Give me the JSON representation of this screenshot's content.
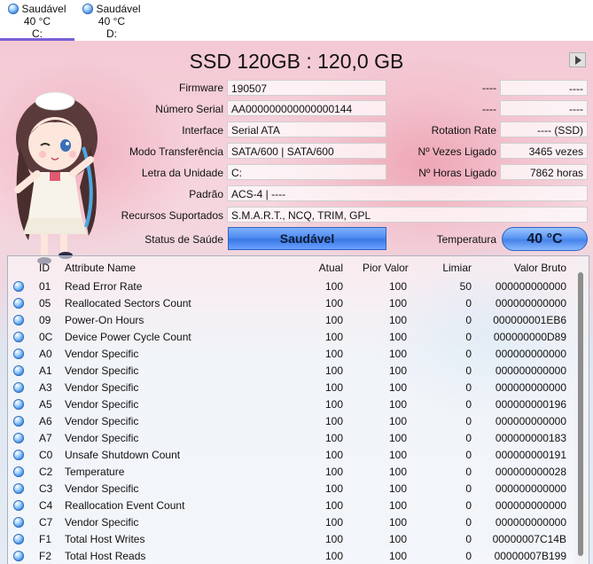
{
  "disks": [
    {
      "status": "Saudável",
      "temp": "40 °C",
      "letter": "C:"
    },
    {
      "status": "Saudável",
      "temp": "40 °C",
      "letter": "D:"
    }
  ],
  "title": "SSD 120GB : 120,0 GB",
  "info": {
    "firmware_label": "Firmware",
    "firmware": "190507",
    "serial_label": "Número Serial",
    "serial": "AA000000000000000144",
    "interface_label": "Interface",
    "interface": "Serial ATA",
    "transfer_label": "Modo Transferência",
    "transfer": "SATA/600 | SATA/600",
    "letter_label": "Letra da Unidade",
    "letter": "C:",
    "standard_label": "Padrão",
    "standard": "ACS-4 | ----",
    "features_label": "Recursos Suportados",
    "features": "S.M.A.R.T., NCQ, TRIM, GPL",
    "health_label": "Status de Saúde",
    "health": "Saudável",
    "temp_label": "Temperatura",
    "temp": "40 °C"
  },
  "right_info": {
    "r1_label": "----",
    "r1": "----",
    "r2_label": "----",
    "r2": "----",
    "rotation_label": "Rotation Rate",
    "rotation": "---- (SSD)",
    "power_count_label": "Nº Vezes Ligado",
    "power_count": "3465 vezes",
    "power_hours_label": "Nº Horas Ligado",
    "power_hours": "7862 horas"
  },
  "table": {
    "headers": {
      "id": "ID",
      "name": "Attribute Name",
      "current": "Atual",
      "worst": "Pior Valor",
      "threshold": "Limiar",
      "raw": "Valor Bruto"
    },
    "rows": [
      {
        "id": "01",
        "name": "Read Error Rate",
        "current": "100",
        "worst": "100",
        "threshold": "50",
        "raw": "000000000000"
      },
      {
        "id": "05",
        "name": "Reallocated Sectors Count",
        "current": "100",
        "worst": "100",
        "threshold": "0",
        "raw": "000000000000"
      },
      {
        "id": "09",
        "name": "Power-On Hours",
        "current": "100",
        "worst": "100",
        "threshold": "0",
        "raw": "000000001EB6"
      },
      {
        "id": "0C",
        "name": "Device Power Cycle Count",
        "current": "100",
        "worst": "100",
        "threshold": "0",
        "raw": "000000000D89"
      },
      {
        "id": "A0",
        "name": "Vendor Specific",
        "current": "100",
        "worst": "100",
        "threshold": "0",
        "raw": "000000000000"
      },
      {
        "id": "A1",
        "name": "Vendor Specific",
        "current": "100",
        "worst": "100",
        "threshold": "0",
        "raw": "000000000000"
      },
      {
        "id": "A3",
        "name": "Vendor Specific",
        "current": "100",
        "worst": "100",
        "threshold": "0",
        "raw": "000000000000"
      },
      {
        "id": "A5",
        "name": "Vendor Specific",
        "current": "100",
        "worst": "100",
        "threshold": "0",
        "raw": "000000000196"
      },
      {
        "id": "A6",
        "name": "Vendor Specific",
        "current": "100",
        "worst": "100",
        "threshold": "0",
        "raw": "000000000000"
      },
      {
        "id": "A7",
        "name": "Vendor Specific",
        "current": "100",
        "worst": "100",
        "threshold": "0",
        "raw": "000000000183"
      },
      {
        "id": "C0",
        "name": "Unsafe Shutdown Count",
        "current": "100",
        "worst": "100",
        "threshold": "0",
        "raw": "000000000191"
      },
      {
        "id": "C2",
        "name": "Temperature",
        "current": "100",
        "worst": "100",
        "threshold": "0",
        "raw": "000000000028"
      },
      {
        "id": "C3",
        "name": "Vendor Specific",
        "current": "100",
        "worst": "100",
        "threshold": "0",
        "raw": "000000000000"
      },
      {
        "id": "C4",
        "name": "Reallocation Event Count",
        "current": "100",
        "worst": "100",
        "threshold": "0",
        "raw": "000000000000"
      },
      {
        "id": "C7",
        "name": "Vendor Specific",
        "current": "100",
        "worst": "100",
        "threshold": "0",
        "raw": "000000000000"
      },
      {
        "id": "F1",
        "name": "Total Host Writes",
        "current": "100",
        "worst": "100",
        "threshold": "0",
        "raw": "00000007C14B"
      },
      {
        "id": "F2",
        "name": "Total Host Reads",
        "current": "100",
        "worst": "100",
        "threshold": "0",
        "raw": "00000007B199"
      }
    ]
  },
  "colors": {
    "accent": "#7a5fd6",
    "health_blue": "#4f8cf0"
  },
  "icons": {
    "status": "good-status-orb-icon",
    "menu": "play-arrow-icon"
  }
}
